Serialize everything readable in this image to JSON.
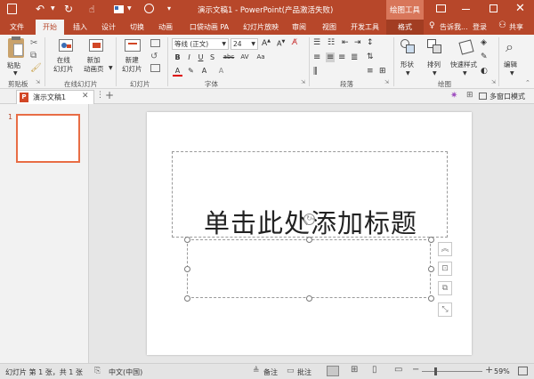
{
  "window": {
    "title": "演示文稿1 - PowerPoint(产品激活失败)",
    "context_tab": "绘图工具",
    "login": "登录"
  },
  "tabs": [
    "文件",
    "开始",
    "插入",
    "设计",
    "切换",
    "动画",
    "口袋动画 PA",
    "幻灯片放映",
    "审阅",
    "视图",
    "开发工具",
    "格式"
  ],
  "tellme": "告诉我...",
  "share": "共享",
  "ribbon": {
    "clipboard": {
      "paste": "粘贴",
      "label": "剪贴板"
    },
    "slides_group": {
      "online_slides": "在线\n幻灯片",
      "new_anim": "新加\n动画页",
      "group_label": "在线幻灯片",
      "new_slide": "新建\n幻灯片",
      "slides_label": "幻灯片"
    },
    "font": {
      "name": "等线 (正文)",
      "size": "24",
      "label": "字体"
    },
    "paragraph": {
      "label": "段落"
    },
    "drawing": {
      "shape": "形状",
      "arrange": "排列",
      "quickstyle": "快速样式",
      "label": "绘图"
    },
    "editing": {
      "label": "编辑"
    }
  },
  "docbar": {
    "tab_title": "演示文稿1",
    "multiwindow": "多窗口模式"
  },
  "thumbnail": {
    "number": "1"
  },
  "slide": {
    "title_placeholder": "单击此处添加标题"
  },
  "status": {
    "slide_info": "幻灯片 第 1 张，共 1 张",
    "language": "中文(中国)",
    "notes": "备注",
    "comments": "批注",
    "zoom": "59%"
  },
  "colors": {
    "accent": "#b7472a",
    "thumb_border": "#e86d45"
  }
}
